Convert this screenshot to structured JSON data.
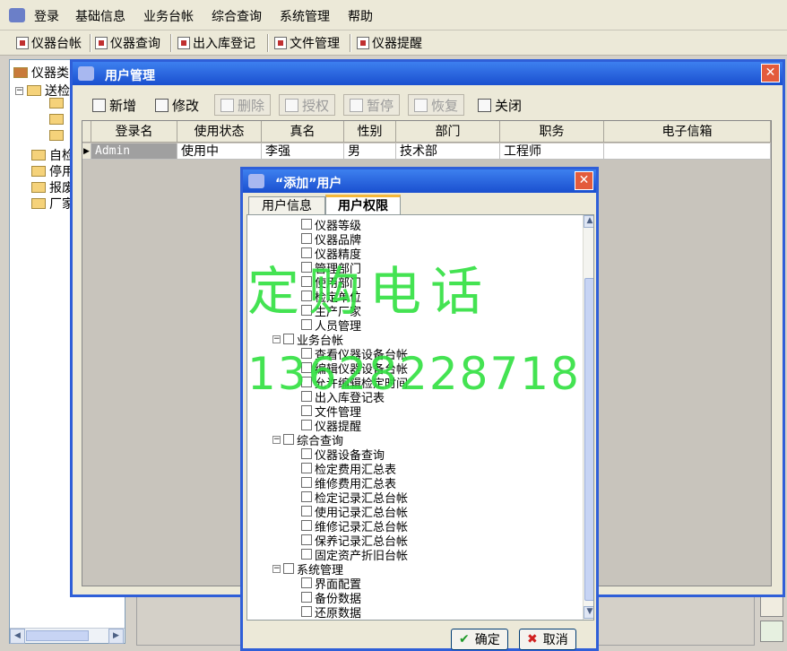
{
  "menu": [
    "登录",
    "基础信息",
    "业务台帐",
    "综合查询",
    "系统管理",
    "帮助"
  ],
  "toolbar": [
    "仪器台帐",
    "仪器查询",
    "出入库登记",
    "文件管理",
    "仪器提醒"
  ],
  "tree": {
    "root": "仪器类",
    "nodes": [
      "送检",
      "自检",
      "停用",
      "报废",
      "厂家"
    ]
  },
  "user_window": {
    "title": "用户管理",
    "buttons": {
      "add": "新增",
      "edit": "修改",
      "delete": "删除",
      "authorize": "授权",
      "pause": "暂停",
      "restore": "恢复",
      "close": "关闭"
    },
    "columns": [
      "登录名",
      "使用状态",
      "真名",
      "性别",
      "部门",
      "职务",
      "电子信箱"
    ],
    "rows": [
      [
        "Admin",
        "使用中",
        "李强",
        "男",
        "技术部",
        "工程师",
        ""
      ]
    ]
  },
  "dialog": {
    "title": "“添加”用户",
    "tabs": [
      "用户信息",
      "用户权限"
    ],
    "permissions": [
      {
        "label": "仪器等级",
        "level": 2
      },
      {
        "label": "仪器品牌",
        "level": 2
      },
      {
        "label": "仪器精度",
        "level": 2
      },
      {
        "label": "管理部门",
        "level": 2
      },
      {
        "label": "使用部门",
        "level": 2
      },
      {
        "label": "检定单位",
        "level": 2
      },
      {
        "label": "生产厂家",
        "level": 2
      },
      {
        "label": "人员管理",
        "level": 2
      },
      {
        "label": "业务台帐",
        "level": 1
      },
      {
        "label": "查看仪器设备台帐",
        "level": 2
      },
      {
        "label": "编辑仪器设备台帐",
        "level": 2
      },
      {
        "label": "允许编辑检定时间",
        "level": 2
      },
      {
        "label": "出入库登记表",
        "level": 2
      },
      {
        "label": "文件管理",
        "level": 2
      },
      {
        "label": "仪器提醒",
        "level": 2
      },
      {
        "label": "综合查询",
        "level": 1
      },
      {
        "label": "仪器设备查询",
        "level": 2
      },
      {
        "label": "检定费用汇总表",
        "level": 2
      },
      {
        "label": "维修费用汇总表",
        "level": 2
      },
      {
        "label": "检定记录汇总台帐",
        "level": 2
      },
      {
        "label": "使用记录汇总台帐",
        "level": 2
      },
      {
        "label": "维修记录汇总台帐",
        "level": 2
      },
      {
        "label": "保养记录汇总台帐",
        "level": 2
      },
      {
        "label": "固定资产折旧台帐",
        "level": 2
      },
      {
        "label": "系统管理",
        "level": 1
      },
      {
        "label": "界面配置",
        "level": 2
      },
      {
        "label": "备份数据",
        "level": 2
      },
      {
        "label": "还原数据",
        "level": 2
      }
    ],
    "ok": "确定",
    "cancel": "取消"
  },
  "watermark": {
    "line1": "定购电话",
    "line2": "13628228718"
  },
  "colors": {
    "title_blue": "#2f5fd8",
    "watermark_green": "#30e040",
    "close_red": "#e35b3c"
  }
}
